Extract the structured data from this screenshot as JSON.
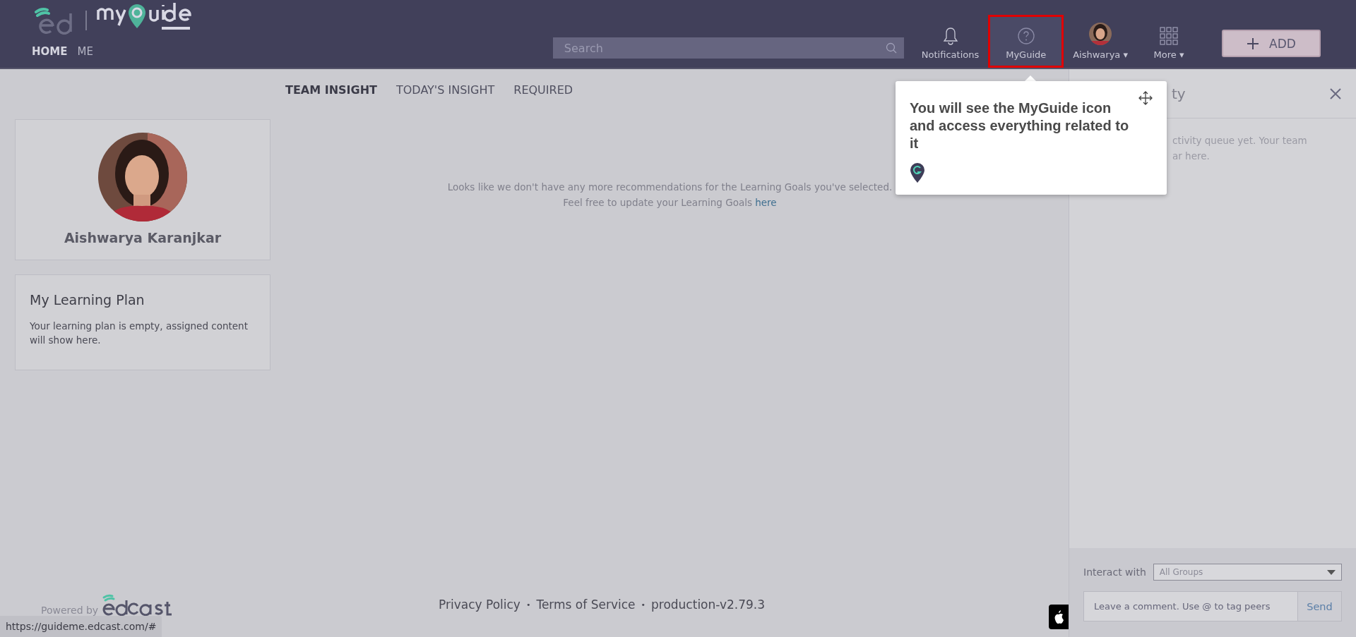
{
  "header": {
    "nav": [
      {
        "label": "HOME",
        "selected": true
      },
      {
        "label": "ME",
        "selected": false
      }
    ],
    "search": {
      "placeholder": "Search"
    },
    "items": [
      {
        "kind": "bell",
        "label": "Notifications",
        "highlighted": false
      },
      {
        "kind": "help",
        "label": "MyGuide",
        "highlighted": true
      },
      {
        "kind": "avatar",
        "label": "Aishwarya ▾",
        "highlighted": false
      },
      {
        "kind": "grid",
        "label": "More ▾",
        "highlighted": false
      }
    ],
    "add_button": "ADD"
  },
  "tabs": [
    {
      "label": "TEAM INSIGHT",
      "selected": true
    },
    {
      "label": "TODAY'S INSIGHT",
      "selected": false
    },
    {
      "label": "REQUIRED",
      "selected": false
    }
  ],
  "profile": {
    "name": "Aishwarya Karanjkar"
  },
  "learning_plan": {
    "title": "My Learning Plan",
    "text": "Your learning plan is empty, assigned content will show here."
  },
  "message": {
    "line1": "Looks like we don't have any more recommendations for the Learning Goals you've selected.",
    "line2": "Feel free to update your Learning Goals",
    "link": "here"
  },
  "tooltip": {
    "text": "You will see the MyGuide icon and access everything related to it"
  },
  "activity_panel": {
    "title": "ty",
    "lines": [
      "ctivity queue yet. Your team",
      "ar here."
    ],
    "interact_label": "Interact with",
    "interact_value": "All Groups",
    "comment_placeholder": "Leave a comment. Use @ to tag peers",
    "send": "Send"
  },
  "footer": {
    "powered_by": "Powered by",
    "links": [
      "Privacy Policy",
      "Terms of Service",
      "production-v2.79.3"
    ],
    "separator": "•"
  },
  "status_url": "https://guideme.edcast.com/#"
}
